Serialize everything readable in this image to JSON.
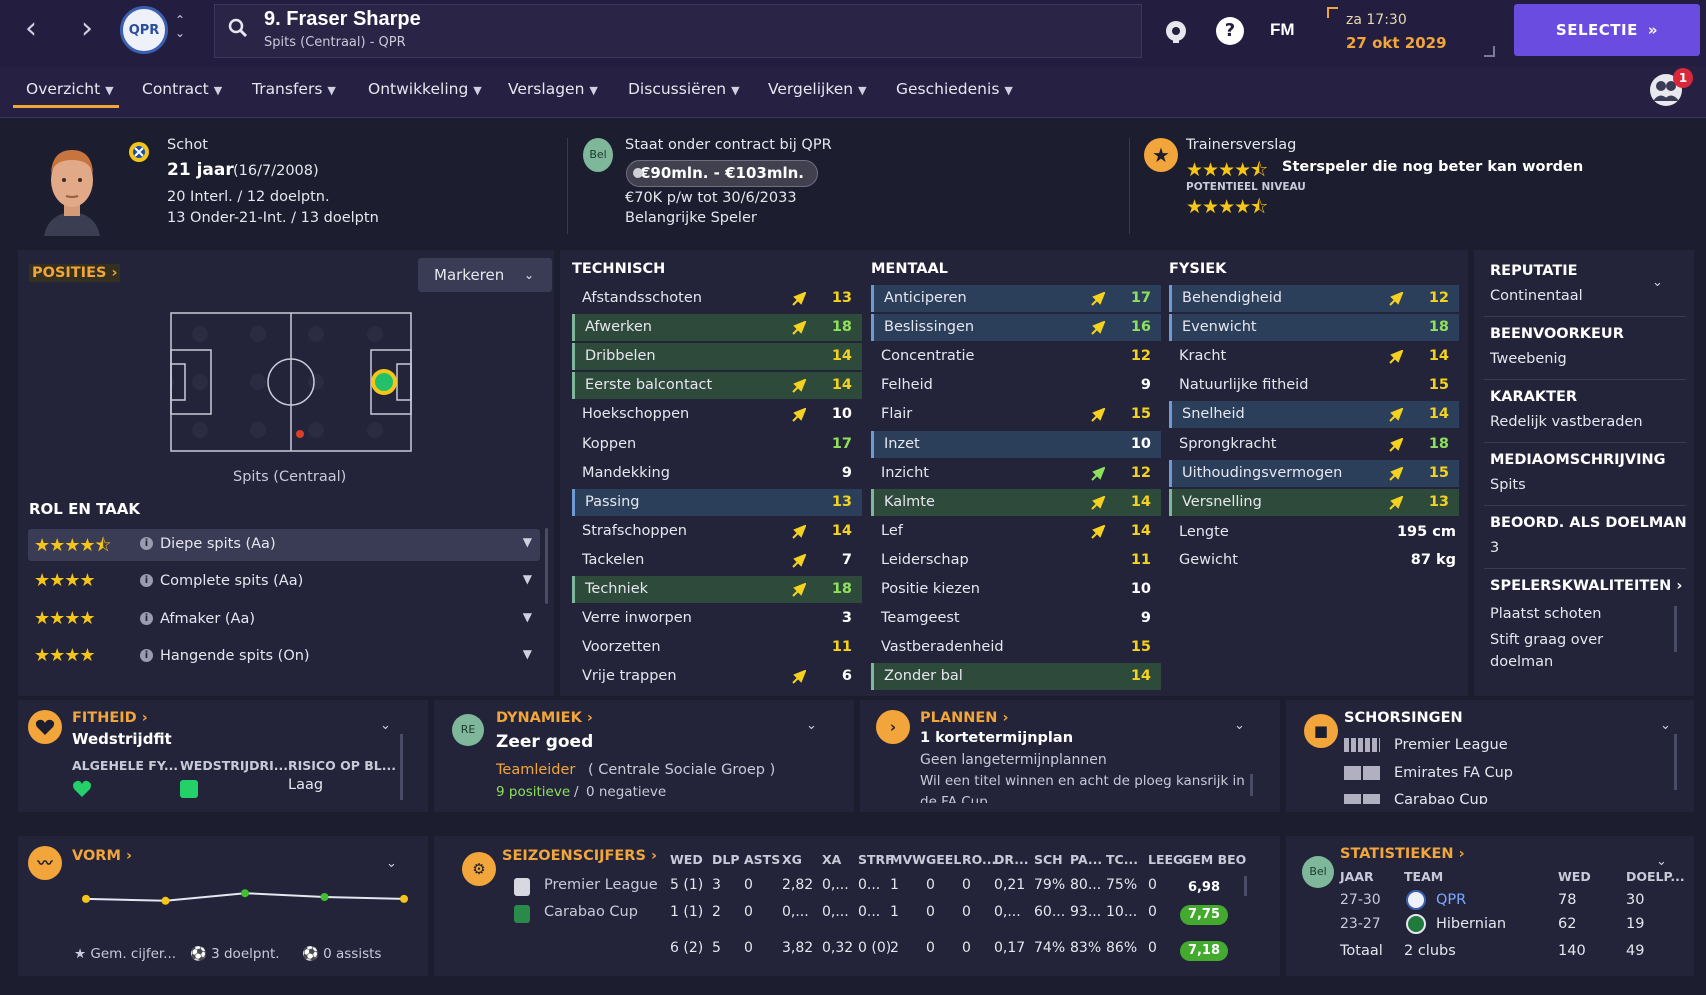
{
  "header": {
    "player_title": "9. Fraser Sharpe",
    "player_subtitle": "Spits (Centraal) - QPR",
    "help_label": "?",
    "fm_label": "FM",
    "time": "za 17:30",
    "date": "27 okt 2029",
    "selectie_label": "SELECTIE",
    "notification_count": "1",
    "club_crest_text": "QPR"
  },
  "tabs": [
    "Overzicht",
    "Contract",
    "Transfers",
    "Ontwikkeling",
    "Verslagen",
    "Discussiëren",
    "Vergelijken",
    "Geschiedenis"
  ],
  "profile": {
    "nationality": "Schot",
    "age": "21 jaar",
    "dob": "(16/7/2008)",
    "caps": "20 Interl. / 12 doelptn.",
    "u21_caps": "13 Onder-21-Int. / 13 doelptn",
    "contract_title": "Staat onder contract bij QPR",
    "value": "€90mln. - €103mln.",
    "wage": "€70K p/w tot 30/6/2033",
    "status": "Belangrijke Speler",
    "bel_badge": "Bel",
    "report_title": "Trainersverslag",
    "report_stars": "★★★★⯪",
    "report_text": "Sterspeler die nog beter kan worden",
    "potential_label": "POTENTIEEL NIVEAU",
    "potential_stars": "★★★★⯪"
  },
  "positions": {
    "heading": "POSITIES",
    "mark_label": "Markeren",
    "position_label": "Spits (Centraal)",
    "role_heading": "ROL EN TAAK",
    "roles": [
      {
        "stars": "★★★★⯪",
        "label": "Diepe spits (Aa)"
      },
      {
        "stars": "★★★★",
        "label": "Complete spits (Aa)"
      },
      {
        "stars": "★★★★",
        "label": "Afmaker (Aa)"
      },
      {
        "stars": "★★★★",
        "label": "Hangende spits (On)"
      }
    ]
  },
  "attributes": {
    "technisch_label": "TECHNISCH",
    "mentaal_label": "MENTAAL",
    "fysiek_label": "FYSIEK",
    "technisch": [
      {
        "name": "Afstandsschoten",
        "value": "13"
      },
      {
        "name": "Afwerken",
        "value": "18"
      },
      {
        "name": "Dribbelen",
        "value": "14"
      },
      {
        "name": "Eerste balcontact",
        "value": "14"
      },
      {
        "name": "Hoekschoppen",
        "value": "10"
      },
      {
        "name": "Koppen",
        "value": "17"
      },
      {
        "name": "Mandekking",
        "value": "9"
      },
      {
        "name": "Passing",
        "value": "13"
      },
      {
        "name": "Strafschoppen",
        "value": "14"
      },
      {
        "name": "Tackelen",
        "value": "7"
      },
      {
        "name": "Techniek",
        "value": "18"
      },
      {
        "name": "Verre inworpen",
        "value": "3"
      },
      {
        "name": "Voorzetten",
        "value": "11"
      },
      {
        "name": "Vrije trappen",
        "value": "6"
      }
    ],
    "mentaal": [
      {
        "name": "Anticiperen",
        "value": "17"
      },
      {
        "name": "Beslissingen",
        "value": "16"
      },
      {
        "name": "Concentratie",
        "value": "12"
      },
      {
        "name": "Felheid",
        "value": "9"
      },
      {
        "name": "Flair",
        "value": "15"
      },
      {
        "name": "Inzet",
        "value": "10"
      },
      {
        "name": "Inzicht",
        "value": "12"
      },
      {
        "name": "Kalmte",
        "value": "14"
      },
      {
        "name": "Lef",
        "value": "14"
      },
      {
        "name": "Leiderschap",
        "value": "11"
      },
      {
        "name": "Positie kiezen",
        "value": "10"
      },
      {
        "name": "Teamgeest",
        "value": "9"
      },
      {
        "name": "Vastberadenheid",
        "value": "15"
      },
      {
        "name": "Zonder bal",
        "value": "14"
      }
    ],
    "fysiek": [
      {
        "name": "Behendigheid",
        "value": "12"
      },
      {
        "name": "Evenwicht",
        "value": "18"
      },
      {
        "name": "Kracht",
        "value": "14"
      },
      {
        "name": "Natuurlijke fitheid",
        "value": "15"
      },
      {
        "name": "Snelheid",
        "value": "14"
      },
      {
        "name": "Sprongkracht",
        "value": "18"
      },
      {
        "name": "Uithoudingsvermogen",
        "value": "15"
      },
      {
        "name": "Versnelling",
        "value": "13"
      }
    ],
    "length_label": "Lengte",
    "length": "195 cm",
    "weight_label": "Gewicht",
    "weight": "87 kg"
  },
  "side": {
    "reputatie_label": "REPUTATIE",
    "reputatie": "Continentaal",
    "foot_label": "BEENVOORKEUR",
    "foot": "Tweebenig",
    "karakter_label": "KARAKTER",
    "karakter": "Redelijk vastberaden",
    "media_label": "MEDIAOMSCHRIJVING",
    "media": "Spits",
    "gk_label": "BEOORD. ALS DOELMAN",
    "gk": "3",
    "qual_label": "SPELERSKWALITEITEN",
    "qual1": "Plaatst schoten",
    "qual2a": "Stift graag over",
    "qual2b": "doelman"
  },
  "fitness": {
    "heading": "FITHEID",
    "status": "Wedstrijdfit",
    "col1": "ALGEHELE FY...",
    "col2": "WEDSTRIJDRI...",
    "col3": "RISICO OP BL...",
    "risk": "Laag"
  },
  "dynamics": {
    "heading": "DYNAMIEK",
    "badge": "RE",
    "value": "Zeer goed",
    "role": "Teamleider",
    "group": "( Centrale Sociale Groep )",
    "positive": "9 positieve",
    "slash": "/",
    "negative": "0 negatieve"
  },
  "plans": {
    "heading": "PLANNEN",
    "short": "1 kortetermijnplan",
    "long": "Geen langetermijnplannen",
    "desc1": "Wil een titel winnen en acht de ploeg kansrijk in",
    "desc2": "de FA Cup"
  },
  "suspensions": {
    "heading": "SCHORSINGEN",
    "items": [
      "Premier League",
      "Emirates FA Cup",
      "Carabao Cup"
    ]
  },
  "form": {
    "heading": "VORM",
    "rating_label": "Gem. cijfer...",
    "goals_label": "3 doelpnt.",
    "assists_label": "0 assists",
    "points": [
      0.4,
      0.35,
      0.55,
      0.45,
      0.4
    ]
  },
  "season": {
    "heading": "SEIZOENSCIJFERS",
    "headers": [
      "WED",
      "DLP",
      "ASTS",
      "XG",
      "XA",
      "STRF",
      "MVW",
      "GEEL",
      "RO...",
      "DR...",
      "SCH",
      "PA...",
      "TC...",
      "LEEG",
      "GEM BEO"
    ],
    "rows": [
      {
        "comp": "Premier League",
        "cells": [
          "5 (1)",
          "3",
          "0",
          "2,82",
          "0,...",
          "0...",
          "1",
          "0",
          "0",
          "0,21",
          "79%",
          "80...",
          "75%",
          "0"
        ],
        "rating": "6,98"
      },
      {
        "comp": "Carabao Cup",
        "cells": [
          "1 (1)",
          "2",
          "0",
          "0,...",
          "0,...",
          "0...",
          "1",
          "0",
          "0",
          "0,...",
          "60...",
          "93...",
          "10...",
          "0"
        ],
        "rating": "7,75"
      }
    ],
    "total": {
      "cells": [
        "6 (2)",
        "5",
        "0",
        "3,82",
        "0,32",
        "0 (0)",
        "2",
        "0",
        "0",
        "0,17",
        "74%",
        "83%",
        "86%",
        "0"
      ],
      "rating": "7,18"
    }
  },
  "stats": {
    "heading": "STATISTIEKEN",
    "badge": "Bel",
    "headers": [
      "JAAR",
      "TEAM",
      "WED",
      "DOELP..."
    ],
    "rows": [
      {
        "year": "27-30",
        "team": "QPR",
        "games": "78",
        "goals": "30"
      },
      {
        "year": "23-27",
        "team": "Hibernian",
        "games": "62",
        "goals": "19"
      }
    ],
    "total_label": "Totaal",
    "total_team": "2 clubs",
    "total_games": "140",
    "total_goals": "49"
  }
}
